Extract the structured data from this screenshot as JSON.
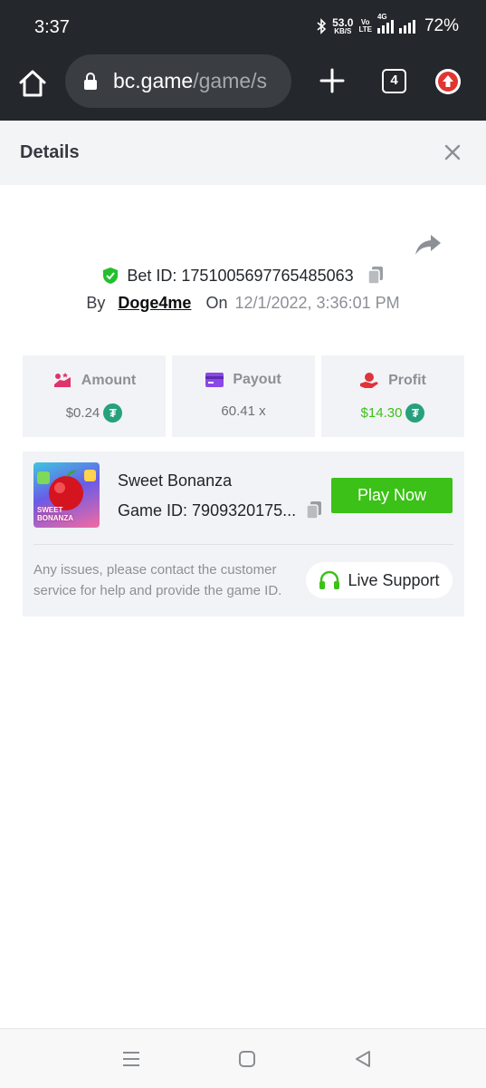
{
  "status_bar": {
    "time": "3:37",
    "net_speed_value": "53.0",
    "net_speed_unit": "KB/S",
    "volte_top": "Vo",
    "volte_bottom": "LTE",
    "network": "4G",
    "battery": "72%"
  },
  "browser": {
    "url_host": "bc.game",
    "url_path": "/game/s",
    "tab_count": "4"
  },
  "details": {
    "title": "Details"
  },
  "bet": {
    "label": "Bet ID:",
    "id": "1751005697765485063",
    "by_label": "By",
    "user": "Doge4me",
    "on_label": "On",
    "datetime": "12/1/2022, 3:36:01 PM"
  },
  "stats": {
    "amount": {
      "label": "Amount",
      "value": "$0.24"
    },
    "payout": {
      "label": "Payout",
      "value": "60.41 x"
    },
    "profit": {
      "label": "Profit",
      "value": "$14.30"
    }
  },
  "game": {
    "name": "Sweet Bonanza",
    "id_label": "Game ID:",
    "id_value": "7909320175...",
    "thumb_line1": "SWEET",
    "thumb_line2": "BONANZA",
    "play_label": "Play Now",
    "issue_text": "Any issues, please contact the customer service for help and provide the game ID.",
    "support_label": "Live Support"
  },
  "colors": {
    "accent_green": "#3bc117",
    "profit_green": "#3bc117",
    "verified_green": "#22c02c",
    "header_dark": "#24272b"
  }
}
